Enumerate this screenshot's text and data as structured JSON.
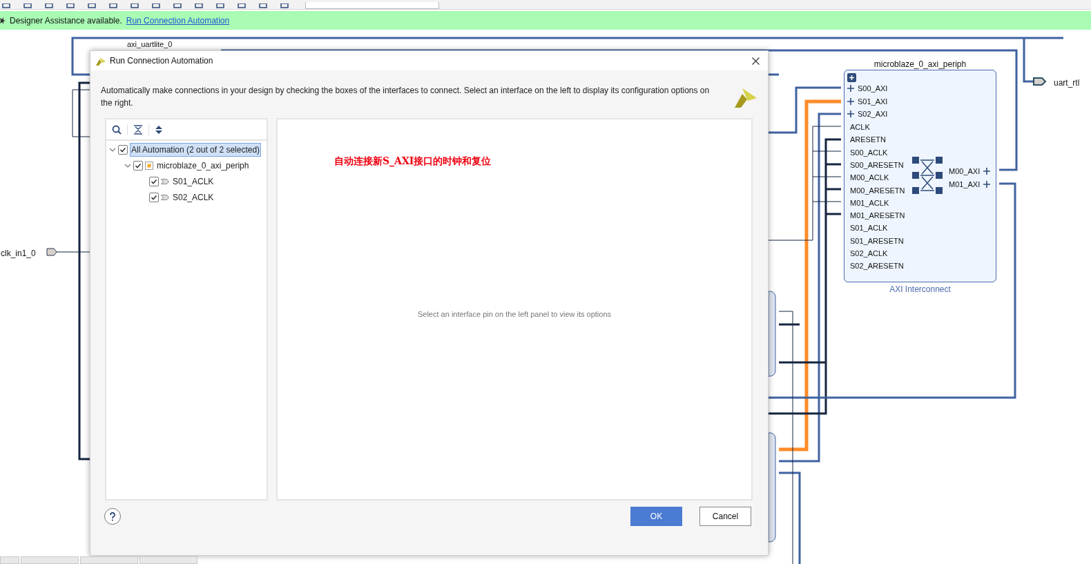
{
  "banner": {
    "text": "Designer Assistance available.",
    "link": "Run Connection Automation"
  },
  "diagram": {
    "uart_label": "axi_uartlite_0",
    "clk_port": "clk_in1_0",
    "out_port": "uart_rtl",
    "interconnect": {
      "title": "microblaze_0_axi_periph",
      "subtitle": "AXI Interconnect",
      "slave_ports": [
        "S00_AXI",
        "S01_AXI",
        "S02_AXI"
      ],
      "signals": [
        "ACLK",
        "ARESETN",
        "S00_ACLK",
        "S00_ARESETN",
        "M00_ACLK",
        "M00_ARESETN",
        "M01_ACLK",
        "M01_ARESETN",
        "S01_ACLK",
        "S01_ARESETN",
        "S02_ACLK",
        "S02_ARESETN"
      ],
      "master_ports": [
        "M00_AXI",
        "M01_AXI"
      ]
    }
  },
  "dialog": {
    "title": "Run Connection Automation",
    "description": "Automatically make connections in your design by checking the boxes of the interfaces to connect. Select an interface on the left to display its configuration options on the right.",
    "tree": [
      {
        "label": "All Automation (2 out of 2 selected)",
        "checked": true,
        "selected": true,
        "expanded": true,
        "children": [
          {
            "label": "microblaze_0_axi_periph",
            "kind": "block",
            "checked": true,
            "selected": false,
            "expanded": true,
            "children": [
              {
                "label": "S01_ACLK",
                "kind": "pin",
                "checked": true,
                "selected": false
              },
              {
                "label": "S02_ACLK",
                "kind": "pin",
                "checked": true,
                "selected": false
              }
            ]
          }
        ]
      }
    ],
    "annotation": "自动连接新S_AXI接口的时钟和复位",
    "hint": "Select an interface pin on the left panel to view its options",
    "buttons": [
      {
        "label": "OK",
        "kind": "primary"
      },
      {
        "label": "Cancel",
        "kind": "secondary"
      }
    ]
  }
}
